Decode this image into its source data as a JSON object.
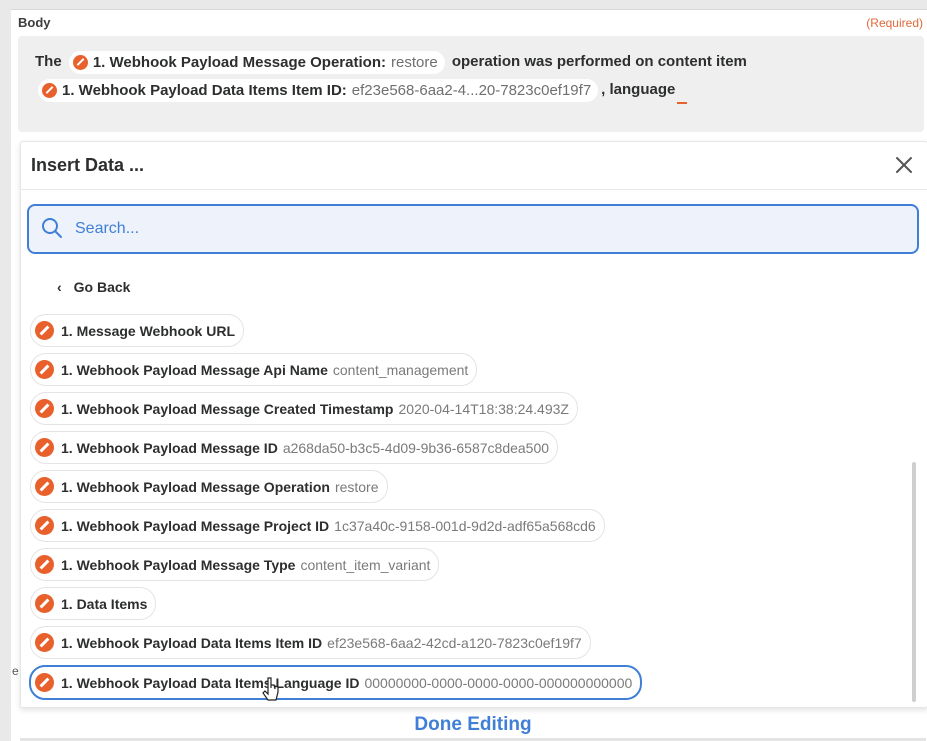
{
  "body_label": "Body",
  "required_label": "(Required)",
  "body_text": {
    "part1": "The",
    "pill1_name": "1. Webhook Payload Message Operation:",
    "pill1_value": "restore",
    "part2": "operation was performed on content item",
    "pill2_name": "1. Webhook Payload Data Items Item ID:",
    "pill2_value": "ef23e568-6aa2-4...20-7823c0ef19f7",
    "part3": ", language"
  },
  "panel": {
    "title": "Insert Data ...",
    "close_icon": "close-icon",
    "search_placeholder": "Search...",
    "go_back": "Go Back"
  },
  "items": [
    {
      "name": "1. Message Webhook URL",
      "value": ""
    },
    {
      "name": "1. Webhook Payload Message Api Name",
      "value": "content_management"
    },
    {
      "name": "1. Webhook Payload Message Created Timestamp",
      "value": "2020-04-14T18:38:24.493Z"
    },
    {
      "name": "1. Webhook Payload Message ID",
      "value": "a268da50-b3c5-4d09-9b36-6587c8dea500"
    },
    {
      "name": "1. Webhook Payload Message Operation",
      "value": "restore"
    },
    {
      "name": "1. Webhook Payload Message Project ID",
      "value": "1c37a40c-9158-001d-9d2d-adf65a568cd6"
    },
    {
      "name": "1. Webhook Payload Message Type",
      "value": "content_item_variant"
    },
    {
      "name": "1. Data Items",
      "value": ""
    },
    {
      "name": "1. Webhook Payload Data Items Item ID",
      "value": "ef23e568-6aa2-42cd-a120-7823c0ef19f7"
    },
    {
      "name": "1. Webhook Payload Data Items Language ID",
      "value": "00000000-0000-0000-0000-000000000000"
    }
  ],
  "done_label": "Done Editing",
  "colors": {
    "accent": "#3f7fd6",
    "zapier_orange": "#e8612c",
    "required": "#e0693a"
  }
}
